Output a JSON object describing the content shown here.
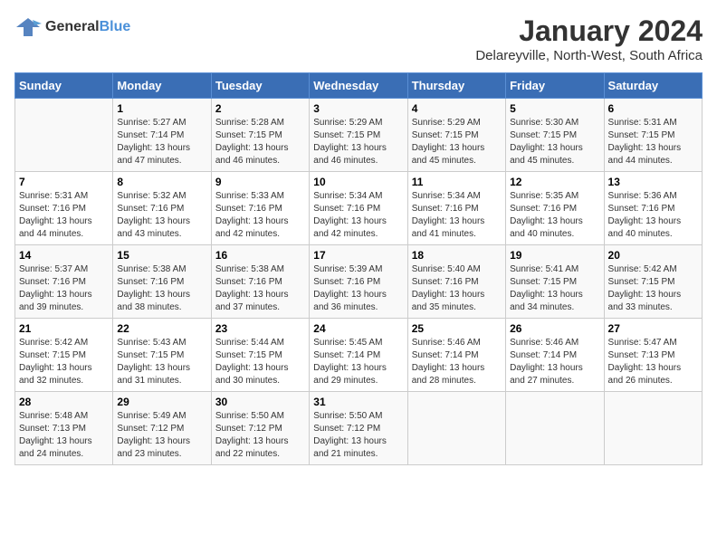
{
  "logo": {
    "line1": "General",
    "line2": "Blue"
  },
  "title": "January 2024",
  "subtitle": "Delareyville, North-West, South Africa",
  "weekdays": [
    "Sunday",
    "Monday",
    "Tuesday",
    "Wednesday",
    "Thursday",
    "Friday",
    "Saturday"
  ],
  "weeks": [
    [
      {
        "day": "",
        "info": ""
      },
      {
        "day": "1",
        "info": "Sunrise: 5:27 AM\nSunset: 7:14 PM\nDaylight: 13 hours\nand 47 minutes."
      },
      {
        "day": "2",
        "info": "Sunrise: 5:28 AM\nSunset: 7:15 PM\nDaylight: 13 hours\nand 46 minutes."
      },
      {
        "day": "3",
        "info": "Sunrise: 5:29 AM\nSunset: 7:15 PM\nDaylight: 13 hours\nand 46 minutes."
      },
      {
        "day": "4",
        "info": "Sunrise: 5:29 AM\nSunset: 7:15 PM\nDaylight: 13 hours\nand 45 minutes."
      },
      {
        "day": "5",
        "info": "Sunrise: 5:30 AM\nSunset: 7:15 PM\nDaylight: 13 hours\nand 45 minutes."
      },
      {
        "day": "6",
        "info": "Sunrise: 5:31 AM\nSunset: 7:15 PM\nDaylight: 13 hours\nand 44 minutes."
      }
    ],
    [
      {
        "day": "7",
        "info": "Sunrise: 5:31 AM\nSunset: 7:16 PM\nDaylight: 13 hours\nand 44 minutes."
      },
      {
        "day": "8",
        "info": "Sunrise: 5:32 AM\nSunset: 7:16 PM\nDaylight: 13 hours\nand 43 minutes."
      },
      {
        "day": "9",
        "info": "Sunrise: 5:33 AM\nSunset: 7:16 PM\nDaylight: 13 hours\nand 42 minutes."
      },
      {
        "day": "10",
        "info": "Sunrise: 5:34 AM\nSunset: 7:16 PM\nDaylight: 13 hours\nand 42 minutes."
      },
      {
        "day": "11",
        "info": "Sunrise: 5:34 AM\nSunset: 7:16 PM\nDaylight: 13 hours\nand 41 minutes."
      },
      {
        "day": "12",
        "info": "Sunrise: 5:35 AM\nSunset: 7:16 PM\nDaylight: 13 hours\nand 40 minutes."
      },
      {
        "day": "13",
        "info": "Sunrise: 5:36 AM\nSunset: 7:16 PM\nDaylight: 13 hours\nand 40 minutes."
      }
    ],
    [
      {
        "day": "14",
        "info": "Sunrise: 5:37 AM\nSunset: 7:16 PM\nDaylight: 13 hours\nand 39 minutes."
      },
      {
        "day": "15",
        "info": "Sunrise: 5:38 AM\nSunset: 7:16 PM\nDaylight: 13 hours\nand 38 minutes."
      },
      {
        "day": "16",
        "info": "Sunrise: 5:38 AM\nSunset: 7:16 PM\nDaylight: 13 hours\nand 37 minutes."
      },
      {
        "day": "17",
        "info": "Sunrise: 5:39 AM\nSunset: 7:16 PM\nDaylight: 13 hours\nand 36 minutes."
      },
      {
        "day": "18",
        "info": "Sunrise: 5:40 AM\nSunset: 7:16 PM\nDaylight: 13 hours\nand 35 minutes."
      },
      {
        "day": "19",
        "info": "Sunrise: 5:41 AM\nSunset: 7:15 PM\nDaylight: 13 hours\nand 34 minutes."
      },
      {
        "day": "20",
        "info": "Sunrise: 5:42 AM\nSunset: 7:15 PM\nDaylight: 13 hours\nand 33 minutes."
      }
    ],
    [
      {
        "day": "21",
        "info": "Sunrise: 5:42 AM\nSunset: 7:15 PM\nDaylight: 13 hours\nand 32 minutes."
      },
      {
        "day": "22",
        "info": "Sunrise: 5:43 AM\nSunset: 7:15 PM\nDaylight: 13 hours\nand 31 minutes."
      },
      {
        "day": "23",
        "info": "Sunrise: 5:44 AM\nSunset: 7:15 PM\nDaylight: 13 hours\nand 30 minutes."
      },
      {
        "day": "24",
        "info": "Sunrise: 5:45 AM\nSunset: 7:14 PM\nDaylight: 13 hours\nand 29 minutes."
      },
      {
        "day": "25",
        "info": "Sunrise: 5:46 AM\nSunset: 7:14 PM\nDaylight: 13 hours\nand 28 minutes."
      },
      {
        "day": "26",
        "info": "Sunrise: 5:46 AM\nSunset: 7:14 PM\nDaylight: 13 hours\nand 27 minutes."
      },
      {
        "day": "27",
        "info": "Sunrise: 5:47 AM\nSunset: 7:13 PM\nDaylight: 13 hours\nand 26 minutes."
      }
    ],
    [
      {
        "day": "28",
        "info": "Sunrise: 5:48 AM\nSunset: 7:13 PM\nDaylight: 13 hours\nand 24 minutes."
      },
      {
        "day": "29",
        "info": "Sunrise: 5:49 AM\nSunset: 7:12 PM\nDaylight: 13 hours\nand 23 minutes."
      },
      {
        "day": "30",
        "info": "Sunrise: 5:50 AM\nSunset: 7:12 PM\nDaylight: 13 hours\nand 22 minutes."
      },
      {
        "day": "31",
        "info": "Sunrise: 5:50 AM\nSunset: 7:12 PM\nDaylight: 13 hours\nand 21 minutes."
      },
      {
        "day": "",
        "info": ""
      },
      {
        "day": "",
        "info": ""
      },
      {
        "day": "",
        "info": ""
      }
    ]
  ]
}
